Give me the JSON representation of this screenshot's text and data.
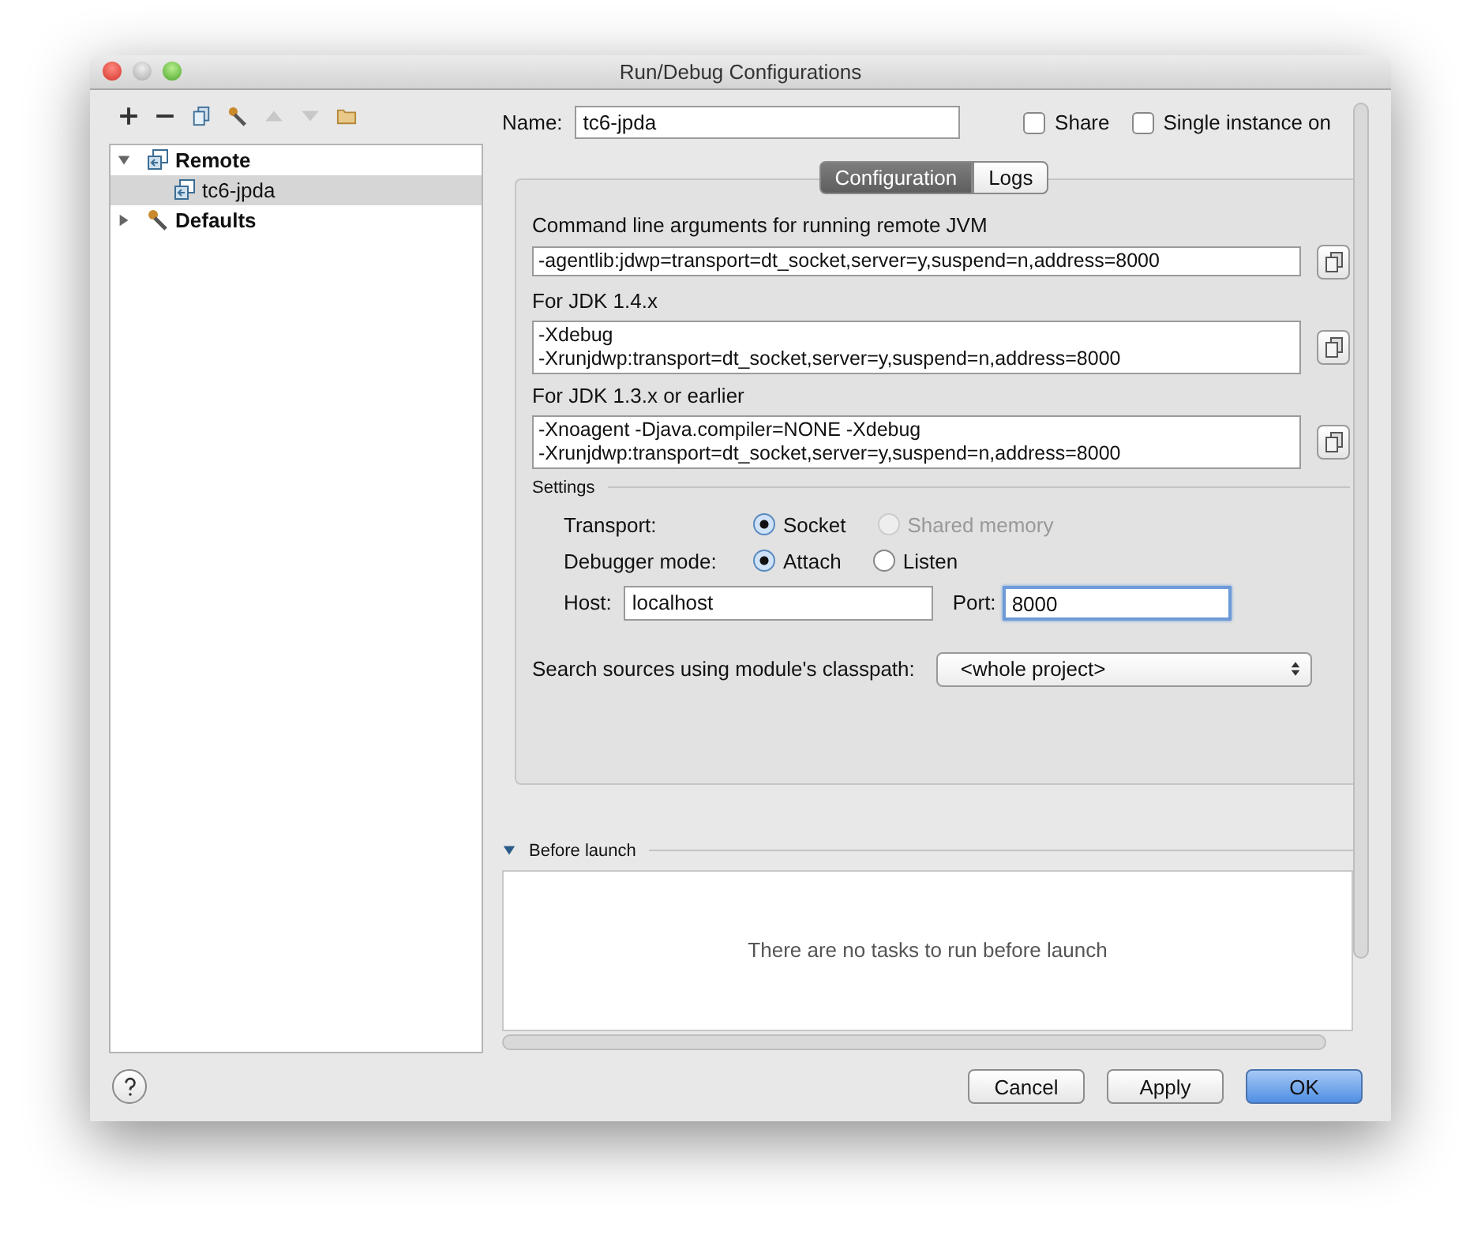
{
  "window": {
    "title": "Run/Debug Configurations"
  },
  "tree": [
    {
      "label": "Remote",
      "expanded": true,
      "selected": false,
      "children": [
        {
          "label": "tc6-jpda",
          "selected": true
        }
      ]
    },
    {
      "label": "Defaults",
      "expanded": false,
      "selected": false
    }
  ],
  "name_field": {
    "label": "Name:",
    "value": "tc6-jpda"
  },
  "options": [
    {
      "label": "Share",
      "checked": false
    },
    {
      "label": "Single instance on",
      "checked": false
    }
  ],
  "tabs": [
    {
      "label": "Configuration",
      "selected": true
    },
    {
      "label": "Logs",
      "selected": false
    }
  ],
  "arguments": [
    {
      "label": "Command line arguments for running remote JVM",
      "lines": [
        "-agentlib:jdwp=transport=dt_socket,server=y,suspend=n,address=8000"
      ]
    },
    {
      "label": "For JDK 1.4.x",
      "lines": [
        "-Xdebug",
        "-Xrunjdwp:transport=dt_socket,server=y,suspend=n,address=8000"
      ]
    },
    {
      "label": "For JDK 1.3.x or earlier",
      "lines": [
        "-Xnoagent -Djava.compiler=NONE -Xdebug",
        "-Xrunjdwp:transport=dt_socket,server=y,suspend=n,address=8000"
      ]
    }
  ],
  "settings": {
    "title": "Settings",
    "rows": [
      {
        "label": "Transport:",
        "options": [
          {
            "label": "Socket",
            "selected": true,
            "disabled": false
          },
          {
            "label": "Shared memory",
            "selected": false,
            "disabled": true
          }
        ]
      },
      {
        "label": "Debugger mode:",
        "options": [
          {
            "label": "Attach",
            "selected": true,
            "disabled": false
          },
          {
            "label": "Listen",
            "selected": false,
            "disabled": false
          }
        ]
      }
    ],
    "host": {
      "label": "Host:",
      "value": "localhost"
    },
    "port": {
      "label": "Port:",
      "value": "8000",
      "focused": true
    },
    "classpath": {
      "label": "Search sources using module's classpath:",
      "value": "<whole project>"
    }
  },
  "before_launch": {
    "title": "Before launch",
    "expanded": true,
    "empty_text": "There are no tasks to run before launch"
  },
  "buttons": [
    {
      "label": "Cancel",
      "kind": "normal"
    },
    {
      "label": "Apply",
      "kind": "normal"
    },
    {
      "label": "OK",
      "kind": "default"
    }
  ]
}
